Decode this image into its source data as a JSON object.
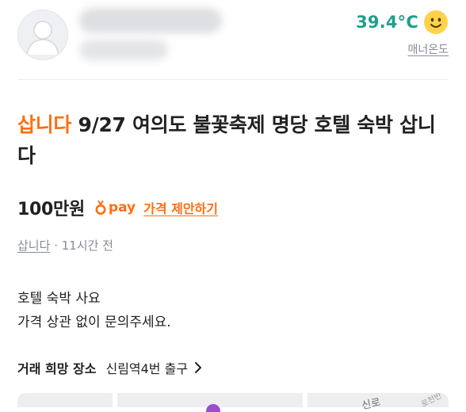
{
  "seller": {
    "avatar_icon": "default-profile-avatar",
    "manner_temp": "39.4°C",
    "manner_face_icon": "smiling-face-icon",
    "manner_label": "매너온도",
    "temp_color": "#1e9f8c"
  },
  "post": {
    "title_tag": "삽니다",
    "title_text": " 9/27 여의도 불꽃축제 명당 호텔 숙박 삽니다",
    "price": "100만원",
    "pay_label": "pay",
    "offer_link": "가격 제안하기",
    "category": "삽니다",
    "time_ago": "· 11시간 전",
    "description_lines": [
      "호텔 숙박 사요",
      "가격 상관 없이 문의주세요."
    ]
  },
  "trade_place": {
    "label": "거래 희망 장소",
    "value": "신림역4번 출구",
    "chevron_icon": "chevron-right-icon"
  },
  "map": {
    "road_label": "신로",
    "road_label2": "로천반",
    "accent": "#ff6f0f"
  }
}
